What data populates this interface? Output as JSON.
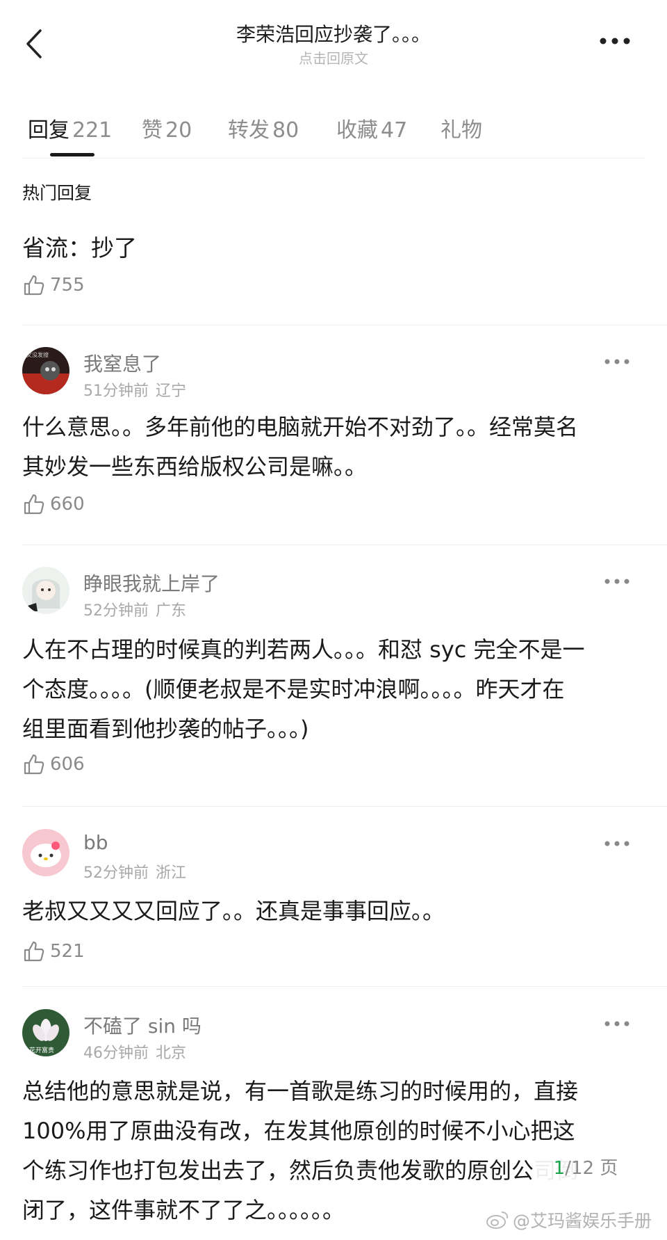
{
  "header": {
    "title": "李荣浩回应抄袭了。。。",
    "subtitle": "点击回原文"
  },
  "tabs": [
    {
      "label": "回复",
      "count": "221"
    },
    {
      "label": "赞",
      "count": "20"
    },
    {
      "label": "转发",
      "count": "80"
    },
    {
      "label": "收藏",
      "count": "47"
    },
    {
      "label": "礼物",
      "count": ""
    }
  ],
  "section_title": "热门回复",
  "hot_reply": {
    "text": "省流：抄了",
    "likes": "755"
  },
  "comments": [
    {
      "username": "我窒息了",
      "time": "51分钟前",
      "location": "辽宁",
      "text": "什么意思。。多年前他的电脑就开始不对劲了。。经常莫名\n其妙发一些东西给版权公司是嘛。。",
      "likes": "660",
      "avatar_text": "文没发搜"
    },
    {
      "username": "睁眼我就上岸了",
      "time": "52分钟前",
      "location": "广东",
      "text": "人在不占理的时候真的判若两人。。。和怼 syc 完全不是一\n个态度。。。。(顺便老叔是不是实时冲浪啊。。。。昨天才在\n组里面看到他抄袭的帖子。。。)",
      "likes": "606"
    },
    {
      "username": "bb",
      "time": "52分钟前",
      "location": "浙江",
      "text": "老叔又又又又回应了。。还真是事事回应。。",
      "likes": "521"
    },
    {
      "username": "不磕了 sin 吗",
      "time": "46分钟前",
      "location": "北京",
      "text": "总结他的意思就是说，有一首歌是练习的时候用的，直接\n100%用了原曲没有改，在发其他原创的时候不小心把这\n个练习作也打包发出去了，然后负责他发歌的原创公司倒\n闭了，这件事就不了了之。。。。。。",
      "avatar_text": "花开富贵"
    }
  ],
  "pager": {
    "current": "1",
    "rest": "/12 页"
  },
  "watermark": "@艾玛酱娱乐手册",
  "colors": {
    "pager_current": "#19a34a",
    "tab_underline": "#1a1a1a",
    "muted": "#8a8a8a"
  }
}
